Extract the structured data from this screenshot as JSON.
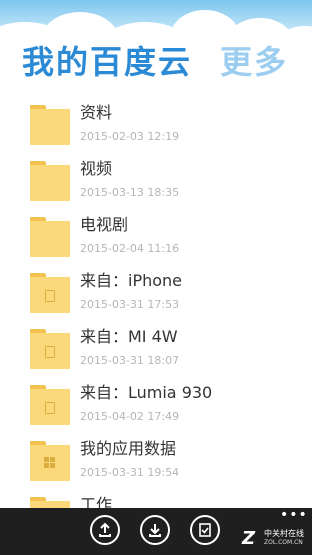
{
  "header": {
    "title": "我的百度云",
    "more": "更多"
  },
  "folders": [
    {
      "name": "资料",
      "date": "2015-02-03 12:19",
      "icon": "folder-icon"
    },
    {
      "name": "视频",
      "date": "2015-03-13 18:35",
      "icon": "folder-icon"
    },
    {
      "name": "电视剧",
      "date": "2015-02-04 11:16",
      "icon": "folder-icon"
    },
    {
      "name": "来自：iPhone",
      "date": "2015-03-31 17:53",
      "icon": "device-folder-icon"
    },
    {
      "name": "来自：MI 4W",
      "date": "2015-03-31 18:07",
      "icon": "device-folder-icon"
    },
    {
      "name": "来自：Lumia 930",
      "date": "2015-04-02 17:49",
      "icon": "device-folder-icon"
    },
    {
      "name": "我的应用数据",
      "date": "2015-03-31 19:54",
      "icon": "app-data-folder-icon"
    },
    {
      "name": "工作",
      "date": "",
      "icon": "folder-icon"
    }
  ],
  "appbar": {
    "buttons": [
      {
        "icon": "upload-icon"
      },
      {
        "icon": "download-icon"
      },
      {
        "icon": "select-icon"
      }
    ],
    "more": "•••"
  },
  "watermark": {
    "logo": "Z",
    "cn": "中关村在线",
    "en": "ZOL.COM.CN"
  },
  "colors": {
    "title": "#2a8ad6",
    "more": "#9bcdf0",
    "folder": "#fbd879",
    "appbar": "#1f1f1f"
  }
}
